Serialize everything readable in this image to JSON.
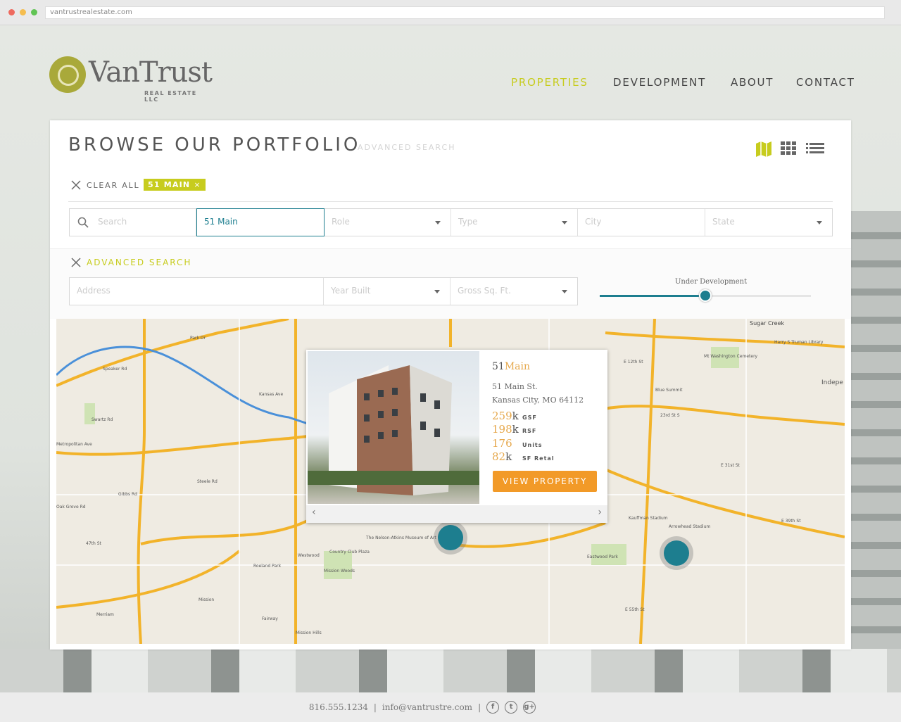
{
  "browser": {
    "url": "vantrustrealestate.com"
  },
  "logo": {
    "name": "VanTrust",
    "sub": "REAL ESTATE LLC"
  },
  "nav": {
    "items": [
      "PROPERTIES",
      "DEVELOPMENT",
      "ABOUT",
      "CONTACT"
    ],
    "active": "PROPERTIES"
  },
  "colors": {
    "accent": "#c7cc1e",
    "teal": "#1d7e8f",
    "orange": "#f29a28"
  },
  "portfolio": {
    "title": "BROWSE OUR PORTFOLIO",
    "advanced_link": "ADVANCED SEARCH",
    "clear_all": "CLEAR ALL",
    "active_filter": "51 MAIN",
    "filters": {
      "search_placeholder": "Search",
      "search_value": "51 Main",
      "role": "Role",
      "type": "Type",
      "city": "City",
      "state": "State"
    },
    "advanced": {
      "title": "ADVANCED SEARCH",
      "address": "Address",
      "year_built": "Year Built",
      "gross_sqft": "Gross Sq. Ft.",
      "slider_label": "Under Development",
      "slider_value": 0.5
    }
  },
  "map": {
    "labels": [
      "Park Dr",
      "Speaker Rd",
      "Swartz Rd",
      "Metropolitan Ave",
      "Gibbs Rd",
      "Oak Grove Rd",
      "47th St",
      "Merriam",
      "Roeland Park",
      "Mission",
      "Westwood",
      "Country Club Plaza",
      "The Nelson-Atkins Museum of Art",
      "Mission Woods",
      "Mission Hills",
      "Fairway",
      "Blue Summit",
      "Kauffman Stadium",
      "Arrowhead Stadium",
      "Eastwood Park",
      "Harry S Truman Library",
      "Mt Washington Cemetery",
      "Sugar Creek",
      "Indepe",
      "E 12th St",
      "23rd St S",
      "E 31st St",
      "E 39th St",
      "E 55th St",
      "Steele Rd",
      "Kansas Ave"
    ]
  },
  "popup": {
    "name_num": "51",
    "name_word": "Main",
    "address1": "51 Main St.",
    "address2": "Kansas City, MO 64112",
    "stats": [
      {
        "num": "259",
        "k": "k",
        "unit": "GSF"
      },
      {
        "num": "198",
        "k": "k",
        "unit": "RSF"
      },
      {
        "num": "176",
        "k": "",
        "unit": "Units"
      },
      {
        "num": "82",
        "k": "k",
        "unit": "SF Retal"
      }
    ],
    "button": "VIEW PROPERTY",
    "prev": "‹",
    "next": "›"
  },
  "footer": {
    "phone": "816.555.1234",
    "email": "info@vantrustre.com",
    "sep": "|",
    "social": [
      "f",
      "t",
      "g+"
    ]
  }
}
